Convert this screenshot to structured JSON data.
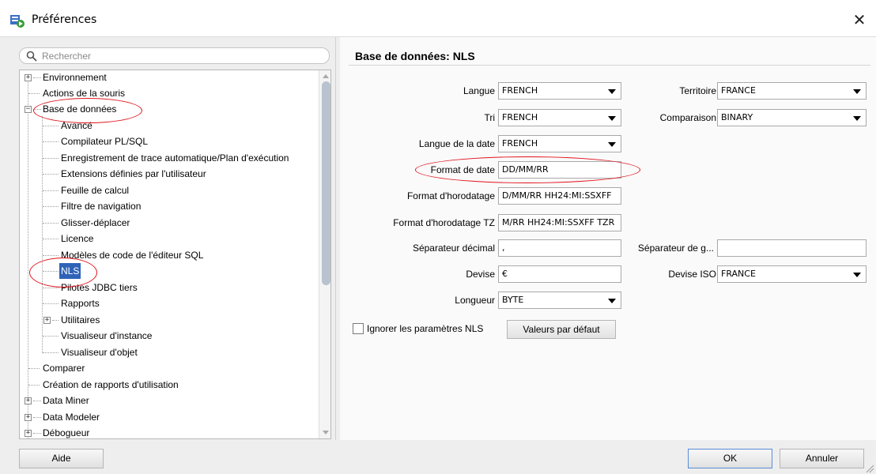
{
  "window": {
    "title": "Préférences",
    "icon": "app-icon",
    "close_glyph": "✕"
  },
  "search": {
    "placeholder": "Rechercher"
  },
  "tree": {
    "items": [
      {
        "label": "Environnement",
        "toggle": "+"
      },
      {
        "label": "Actions de la souris"
      },
      {
        "label": "Base de données",
        "toggle": "−"
      },
      {
        "label": "Avancé"
      },
      {
        "label": "Compilateur PL/SQL"
      },
      {
        "label": "Enregistrement de trace automatique/Plan d'exécution"
      },
      {
        "label": "Extensions définies par l'utilisateur"
      },
      {
        "label": "Feuille de calcul"
      },
      {
        "label": "Filtre de navigation"
      },
      {
        "label": "Glisser-déplacer"
      },
      {
        "label": "Licence"
      },
      {
        "label": "Modèles de code de l'éditeur SQL"
      },
      {
        "label": "NLS",
        "selected": true
      },
      {
        "label": "Pilotes JDBC tiers"
      },
      {
        "label": "Rapports"
      },
      {
        "label": "Utilitaires",
        "toggle": "+"
      },
      {
        "label": "Visualiseur d'instance"
      },
      {
        "label": "Visualiseur d'objet"
      },
      {
        "label": "Comparer"
      },
      {
        "label": "Création de rapports d'utilisation"
      },
      {
        "label": "Data Miner",
        "toggle": "+"
      },
      {
        "label": "Data Modeler",
        "toggle": "+"
      },
      {
        "label": "Débogueur",
        "toggle": "+"
      }
    ]
  },
  "panel": {
    "title": "Base de données: NLS",
    "langue_label": "Langue",
    "langue_value": "FRENCH",
    "territoire_label": "Territoire",
    "territoire_value": "FRANCE",
    "tri_label": "Tri",
    "tri_value": "FRENCH",
    "comparaison_label": "Comparaison",
    "comparaison_value": "BINARY",
    "langue_date_label": "Langue de la date",
    "langue_date_value": "FRENCH",
    "format_date_label": "Format de date",
    "format_date_value": "DD/MM/RR",
    "format_horodatage_label": "Format d'horodatage",
    "format_horodatage_value": "D/MM/RR HH24:MI:SSXFF",
    "format_horodatage_tz_label": "Format d'horodatage TZ",
    "format_horodatage_tz_value": "M/RR HH24:MI:SSXFF TZR",
    "separateur_decimal_label": "Séparateur décimal",
    "separateur_decimal_value": ",",
    "separateur_groupe_label": "Séparateur de g...",
    "separateur_groupe_value": "",
    "devise_label": "Devise",
    "devise_value": "€",
    "devise_iso_label": "Devise ISO",
    "devise_iso_value": "FRANCE",
    "longueur_label": "Longueur",
    "longueur_value": "BYTE",
    "ignorer_label": "Ignorer les paramètres NLS",
    "ignorer_checked": false,
    "defaults_button": "Valeurs par défaut"
  },
  "footer": {
    "help_button": "Aide",
    "ok_button": "OK",
    "cancel_button": "Annuler"
  },
  "colors": {
    "selection": "#2f63b8",
    "highlight_ellipse": "#e0141e",
    "ok_border": "#5a8bd6"
  }
}
